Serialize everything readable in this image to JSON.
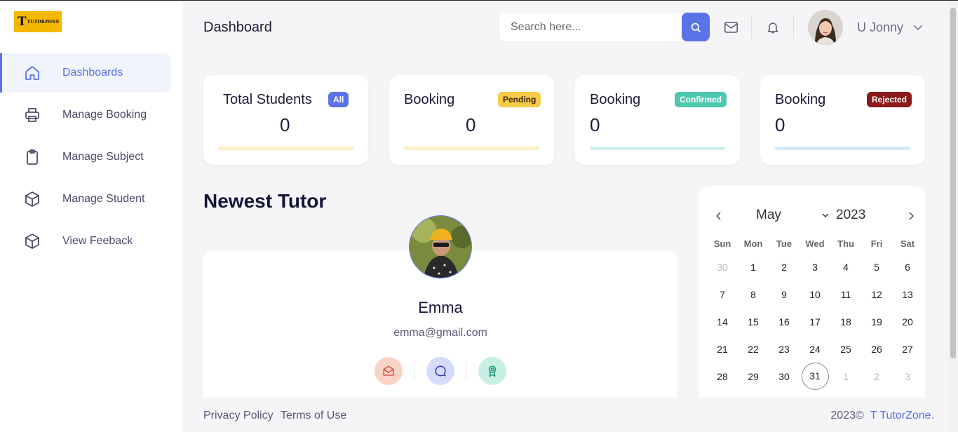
{
  "brand": {
    "logo_mark": "T",
    "logo_text": "TUTORZONE",
    "logo_color": "#f5b700"
  },
  "sidebar": {
    "items": [
      {
        "label": "Dashboards",
        "icon": "home-icon",
        "active": true
      },
      {
        "label": "Manage Booking",
        "icon": "printer-icon",
        "active": false
      },
      {
        "label": "Manage Subject",
        "icon": "clipboard-icon",
        "active": false
      },
      {
        "label": "Manage Student",
        "icon": "cube-icon",
        "active": false
      },
      {
        "label": "View Feeback",
        "icon": "cube-icon",
        "active": false
      }
    ]
  },
  "header": {
    "title": "Dashboard",
    "search_placeholder": "Search here...",
    "user_name": "U Jonny"
  },
  "stats": [
    {
      "title": "Total Students",
      "badge": "All",
      "value": "0",
      "badge_color": "#5b73e8"
    },
    {
      "title": "Booking",
      "badge": "Pending",
      "value": "0",
      "badge_color": "#f7c948"
    },
    {
      "title": "Booking",
      "badge": "Confirmed",
      "value": "0",
      "badge_color": "#4dc9b0"
    },
    {
      "title": "Booking",
      "badge": "Rejected",
      "value": "0",
      "badge_color": "#8b1a1a"
    }
  ],
  "newest_tutor": {
    "section_title": "Newest Tutor",
    "name": "Emma",
    "email": "emma@gmail.com"
  },
  "calendar": {
    "month": "May",
    "year": "2023",
    "weekdays": [
      "Sun",
      "Mon",
      "Tue",
      "Wed",
      "Thu",
      "Fri",
      "Sat"
    ],
    "weeks": [
      [
        "30",
        "1",
        "2",
        "3",
        "4",
        "5",
        "6"
      ],
      [
        "7",
        "8",
        "9",
        "10",
        "11",
        "12",
        "13"
      ],
      [
        "14",
        "15",
        "16",
        "17",
        "18",
        "19",
        "20"
      ],
      [
        "21",
        "22",
        "23",
        "24",
        "25",
        "26",
        "27"
      ],
      [
        "28",
        "29",
        "30",
        "31",
        "1",
        "2",
        "3"
      ]
    ],
    "today": "31"
  },
  "footer": {
    "privacy": "Privacy Policy",
    "terms": "Terms of Use",
    "copyright": "2023©",
    "brand": "T TutorZone."
  },
  "colors": {
    "accent": "#5b73e8",
    "text_dark": "#1c1c3a"
  }
}
